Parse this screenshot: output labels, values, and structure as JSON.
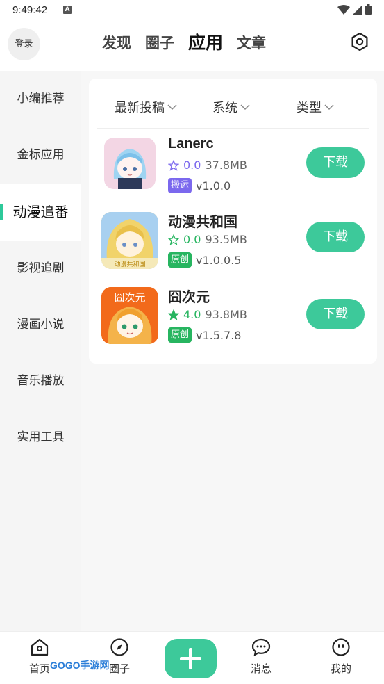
{
  "status_bar": {
    "time": "9:49:42",
    "indicator": "A"
  },
  "header": {
    "login_label": "登录",
    "tabs": [
      {
        "label": "发现",
        "active": false
      },
      {
        "label": "圈子",
        "active": false
      },
      {
        "label": "应用",
        "active": true
      },
      {
        "label": "文章",
        "active": false
      }
    ]
  },
  "sidebar": {
    "items": [
      {
        "label": "小编推荐"
      },
      {
        "label": "金标应用"
      },
      {
        "label": "动漫追番",
        "active": true
      },
      {
        "label": "影视追剧"
      },
      {
        "label": "漫画小说"
      },
      {
        "label": "音乐播放"
      },
      {
        "label": "实用工具"
      }
    ]
  },
  "filters": {
    "latest": "最新投稿",
    "system": "系统",
    "type": "类型"
  },
  "apps": [
    {
      "name": "Lanerc",
      "rating": "0.0",
      "size": "37.8MB",
      "badge": "搬运",
      "badge_color": "#7b68ee",
      "version": "v1.0.0",
      "rated": false,
      "star_color": "#7b68ee",
      "button": "下载"
    },
    {
      "name": "动漫共和国",
      "rating": "0.0",
      "size": "93.5MB",
      "badge": "原创",
      "badge_color": "#27b560",
      "version": "v1.0.0.5",
      "rated": false,
      "star_color": "#27b560",
      "button": "下载"
    },
    {
      "name": "囧次元",
      "rating": "4.0",
      "size": "93.8MB",
      "badge": "原创",
      "badge_color": "#27b560",
      "version": "v1.5.7.8",
      "rated": true,
      "star_color": "#27b560",
      "button": "下载"
    }
  ],
  "bottom_nav": {
    "home": "首页",
    "circle": "圈子",
    "messages": "消息",
    "mine": "我的",
    "watermark": "GOGO手游网"
  },
  "colors": {
    "accent": "#3dc99a"
  }
}
